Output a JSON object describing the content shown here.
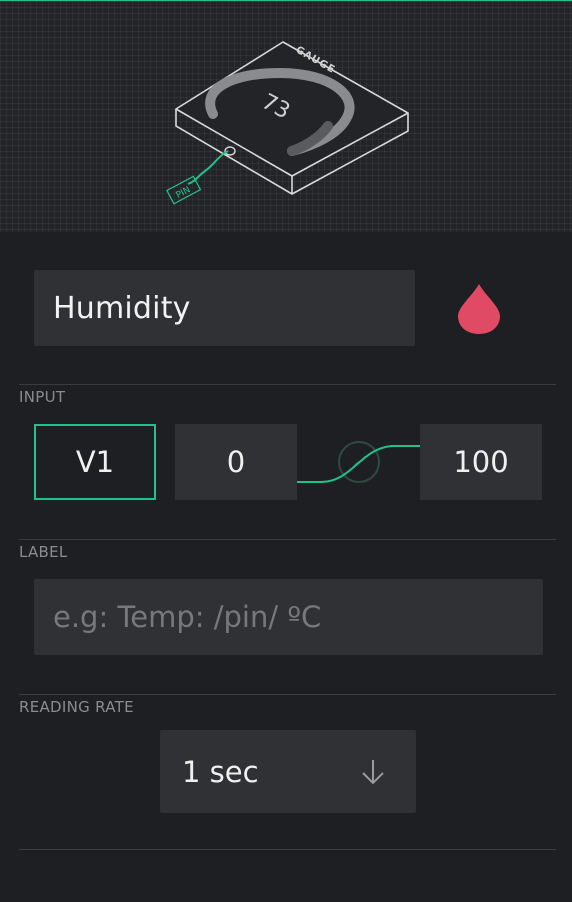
{
  "widget_preview": {
    "device_label": "GAUGE",
    "gauge_value": "73",
    "pin_tag": "PIN"
  },
  "name_field": {
    "value": "Humidity"
  },
  "color_picker": {
    "icon": "drop-icon",
    "color": "#e04a64"
  },
  "input_section": {
    "title": "INPUT",
    "pin": "V1",
    "min": "0",
    "max": "100"
  },
  "label_section": {
    "title": "LABEL",
    "placeholder": "e.g: Temp: /pin/ ºC",
    "value": ""
  },
  "reading_rate_section": {
    "title": "READING RATE",
    "selected": "1 sec",
    "icon": "arrow-down-icon"
  },
  "colors": {
    "accent": "#21c28a",
    "background": "#1e1f22",
    "field": "#303135"
  }
}
